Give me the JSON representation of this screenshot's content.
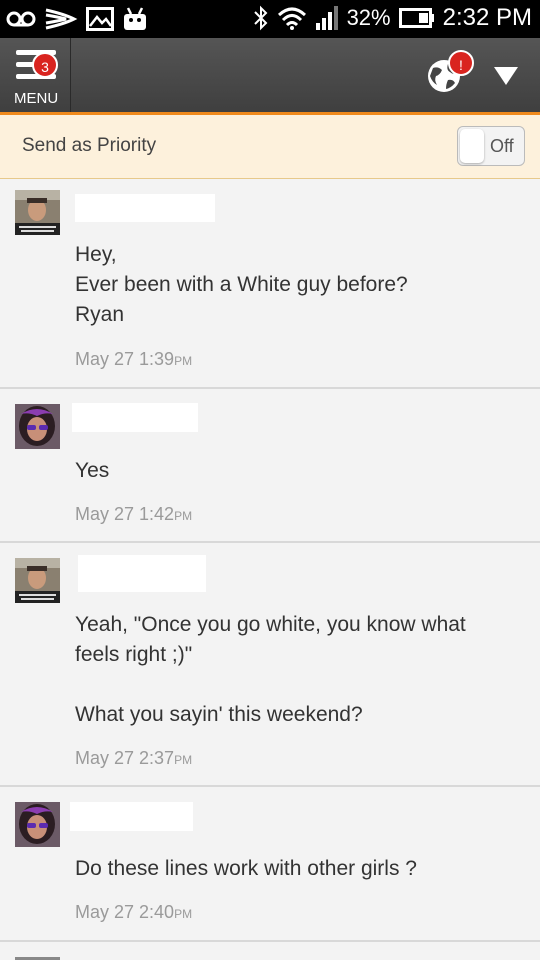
{
  "status_bar": {
    "battery": "32%",
    "time": "2:32 PM"
  },
  "app_bar": {
    "menu_label": "MENU",
    "menu_badge": "3",
    "globe_badge": "!"
  },
  "priority": {
    "label": "Send as Priority",
    "toggle_state": "Off"
  },
  "messages": [
    {
      "text": "Hey,\nEver been with a White guy before?\nRyan",
      "date": "May 27 1:39",
      "ampm": "PM"
    },
    {
      "text": "Yes",
      "date": "May 27 1:42",
      "ampm": "PM"
    },
    {
      "text": "Yeah, \"Once you go white, you know what feels right ;)\"\n\nWhat you sayin' this weekend?",
      "date": "May 27 2:37",
      "ampm": "PM"
    },
    {
      "text": "Do these lines work with other girls ?",
      "date": "May 27 2:40",
      "ampm": "PM"
    }
  ]
}
